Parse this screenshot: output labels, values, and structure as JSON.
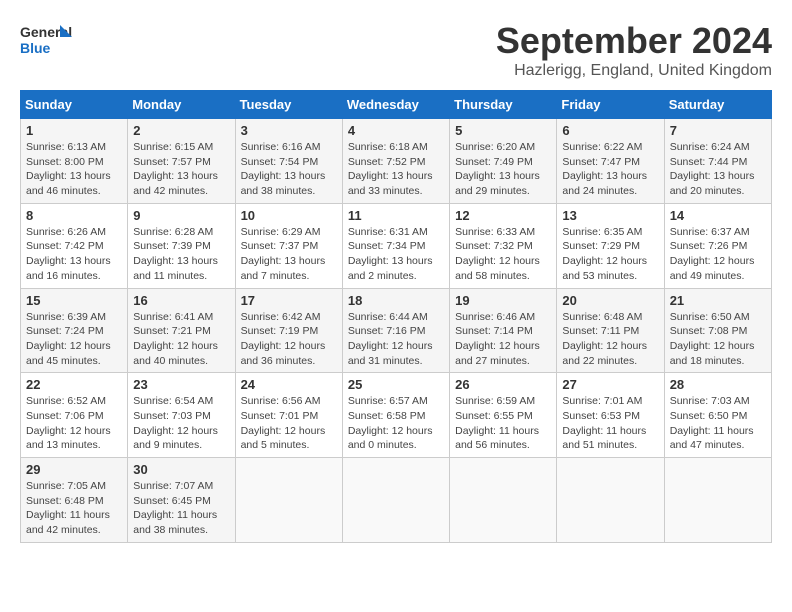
{
  "logo": {
    "line1": "General",
    "line2": "Blue"
  },
  "title": "September 2024",
  "location": "Hazlerigg, England, United Kingdom",
  "days_header": [
    "Sunday",
    "Monday",
    "Tuesday",
    "Wednesday",
    "Thursday",
    "Friday",
    "Saturday"
  ],
  "weeks": [
    [
      {
        "day": "1",
        "info": "Sunrise: 6:13 AM\nSunset: 8:00 PM\nDaylight: 13 hours\nand 46 minutes."
      },
      {
        "day": "2",
        "info": "Sunrise: 6:15 AM\nSunset: 7:57 PM\nDaylight: 13 hours\nand 42 minutes."
      },
      {
        "day": "3",
        "info": "Sunrise: 6:16 AM\nSunset: 7:54 PM\nDaylight: 13 hours\nand 38 minutes."
      },
      {
        "day": "4",
        "info": "Sunrise: 6:18 AM\nSunset: 7:52 PM\nDaylight: 13 hours\nand 33 minutes."
      },
      {
        "day": "5",
        "info": "Sunrise: 6:20 AM\nSunset: 7:49 PM\nDaylight: 13 hours\nand 29 minutes."
      },
      {
        "day": "6",
        "info": "Sunrise: 6:22 AM\nSunset: 7:47 PM\nDaylight: 13 hours\nand 24 minutes."
      },
      {
        "day": "7",
        "info": "Sunrise: 6:24 AM\nSunset: 7:44 PM\nDaylight: 13 hours\nand 20 minutes."
      }
    ],
    [
      {
        "day": "8",
        "info": "Sunrise: 6:26 AM\nSunset: 7:42 PM\nDaylight: 13 hours\nand 16 minutes."
      },
      {
        "day": "9",
        "info": "Sunrise: 6:28 AM\nSunset: 7:39 PM\nDaylight: 13 hours\nand 11 minutes."
      },
      {
        "day": "10",
        "info": "Sunrise: 6:29 AM\nSunset: 7:37 PM\nDaylight: 13 hours\nand 7 minutes."
      },
      {
        "day": "11",
        "info": "Sunrise: 6:31 AM\nSunset: 7:34 PM\nDaylight: 13 hours\nand 2 minutes."
      },
      {
        "day": "12",
        "info": "Sunrise: 6:33 AM\nSunset: 7:32 PM\nDaylight: 12 hours\nand 58 minutes."
      },
      {
        "day": "13",
        "info": "Sunrise: 6:35 AM\nSunset: 7:29 PM\nDaylight: 12 hours\nand 53 minutes."
      },
      {
        "day": "14",
        "info": "Sunrise: 6:37 AM\nSunset: 7:26 PM\nDaylight: 12 hours\nand 49 minutes."
      }
    ],
    [
      {
        "day": "15",
        "info": "Sunrise: 6:39 AM\nSunset: 7:24 PM\nDaylight: 12 hours\nand 45 minutes."
      },
      {
        "day": "16",
        "info": "Sunrise: 6:41 AM\nSunset: 7:21 PM\nDaylight: 12 hours\nand 40 minutes."
      },
      {
        "day": "17",
        "info": "Sunrise: 6:42 AM\nSunset: 7:19 PM\nDaylight: 12 hours\nand 36 minutes."
      },
      {
        "day": "18",
        "info": "Sunrise: 6:44 AM\nSunset: 7:16 PM\nDaylight: 12 hours\nand 31 minutes."
      },
      {
        "day": "19",
        "info": "Sunrise: 6:46 AM\nSunset: 7:14 PM\nDaylight: 12 hours\nand 27 minutes."
      },
      {
        "day": "20",
        "info": "Sunrise: 6:48 AM\nSunset: 7:11 PM\nDaylight: 12 hours\nand 22 minutes."
      },
      {
        "day": "21",
        "info": "Sunrise: 6:50 AM\nSunset: 7:08 PM\nDaylight: 12 hours\nand 18 minutes."
      }
    ],
    [
      {
        "day": "22",
        "info": "Sunrise: 6:52 AM\nSunset: 7:06 PM\nDaylight: 12 hours\nand 13 minutes."
      },
      {
        "day": "23",
        "info": "Sunrise: 6:54 AM\nSunset: 7:03 PM\nDaylight: 12 hours\nand 9 minutes."
      },
      {
        "day": "24",
        "info": "Sunrise: 6:56 AM\nSunset: 7:01 PM\nDaylight: 12 hours\nand 5 minutes."
      },
      {
        "day": "25",
        "info": "Sunrise: 6:57 AM\nSunset: 6:58 PM\nDaylight: 12 hours\nand 0 minutes."
      },
      {
        "day": "26",
        "info": "Sunrise: 6:59 AM\nSunset: 6:55 PM\nDaylight: 11 hours\nand 56 minutes."
      },
      {
        "day": "27",
        "info": "Sunrise: 7:01 AM\nSunset: 6:53 PM\nDaylight: 11 hours\nand 51 minutes."
      },
      {
        "day": "28",
        "info": "Sunrise: 7:03 AM\nSunset: 6:50 PM\nDaylight: 11 hours\nand 47 minutes."
      }
    ],
    [
      {
        "day": "29",
        "info": "Sunrise: 7:05 AM\nSunset: 6:48 PM\nDaylight: 11 hours\nand 42 minutes."
      },
      {
        "day": "30",
        "info": "Sunrise: 7:07 AM\nSunset: 6:45 PM\nDaylight: 11 hours\nand 38 minutes."
      },
      {
        "day": "",
        "info": ""
      },
      {
        "day": "",
        "info": ""
      },
      {
        "day": "",
        "info": ""
      },
      {
        "day": "",
        "info": ""
      },
      {
        "day": "",
        "info": ""
      }
    ]
  ]
}
